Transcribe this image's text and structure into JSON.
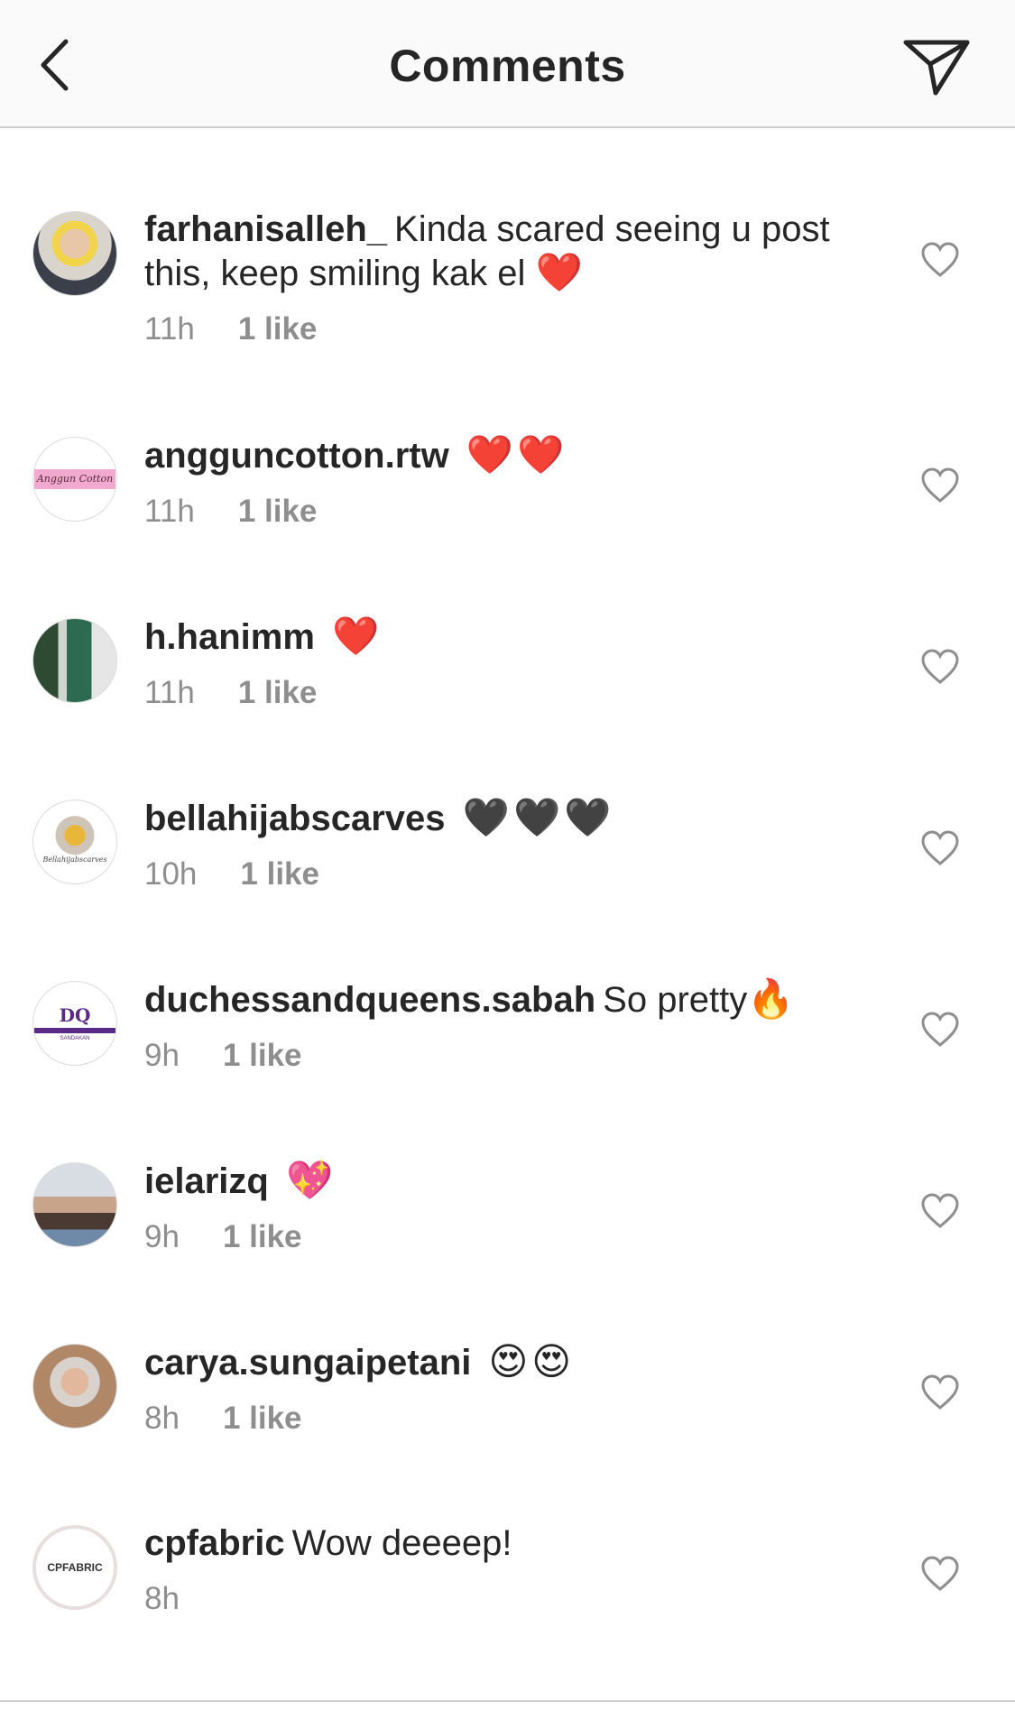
{
  "header": {
    "title": "Comments"
  },
  "comments": [
    {
      "user": "farhanisalleh_",
      "text": "Kinda scared seeing u post this, keep smiling kak el",
      "emoji": "❤️",
      "time": "11h",
      "likes": "1 like"
    },
    {
      "user": "angguncotton.rtw",
      "text": "",
      "emoji": "❤️❤️",
      "time": "11h",
      "likes": "1 like",
      "avatar_text": "Anggun Cotton"
    },
    {
      "user": "h.hanimm",
      "text": "",
      "emoji": "❤️",
      "time": "11h",
      "likes": "1 like"
    },
    {
      "user": "bellahijabscarves",
      "text": "",
      "emoji": "🖤🖤🖤",
      "time": "10h",
      "likes": "1 like",
      "avatar_text": "Bellahijabscarves"
    },
    {
      "user": "duchessandqueens.sabah",
      "text": "So pretty",
      "emoji": "🔥",
      "time": "9h",
      "likes": "1 like",
      "avatar_text": "DQ",
      "avatar_caption": "SANDAKAN"
    },
    {
      "user": "ielarizq",
      "text": "",
      "emoji": "💖",
      "time": "9h",
      "likes": "1 like"
    },
    {
      "user": "carya.sungaipetani",
      "text": "",
      "emoji": "😍😍",
      "time": "8h",
      "likes": "1 like"
    },
    {
      "user": "cpfabric",
      "text": "Wow deeeep!",
      "emoji": "",
      "time": "8h",
      "likes": "",
      "avatar_text": "CPFABRIC"
    }
  ]
}
